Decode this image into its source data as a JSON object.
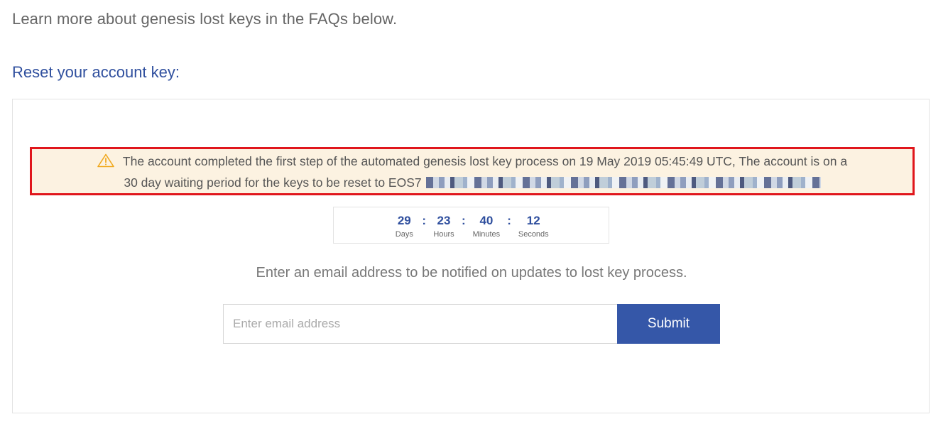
{
  "intro_text": "Learn more about genesis lost keys in the FAQs below.",
  "section_title": "Reset your account key:",
  "alert": {
    "icon": "warning-triangle-icon",
    "line1": "The account completed the first step of the automated genesis lost key process on 19 May 2019 05:45:49 UTC, The account is on a",
    "line2": "30 day waiting period for the keys to be reset to EOS7",
    "highlight_color": "#e0161c",
    "background_color": "#fcf2e1"
  },
  "countdown": {
    "days": "29",
    "days_label": "Days",
    "hours": "23",
    "hours_label": "Hours",
    "minutes": "40",
    "minutes_label": "Minutes",
    "seconds": "12",
    "seconds_label": "Seconds",
    "separator": ":"
  },
  "notify_text": "Enter an email address to be notified on updates to lost key process.",
  "form": {
    "email_placeholder": "Enter email address",
    "email_value": "",
    "submit_label": "Submit",
    "accent_color": "#3557a8"
  }
}
